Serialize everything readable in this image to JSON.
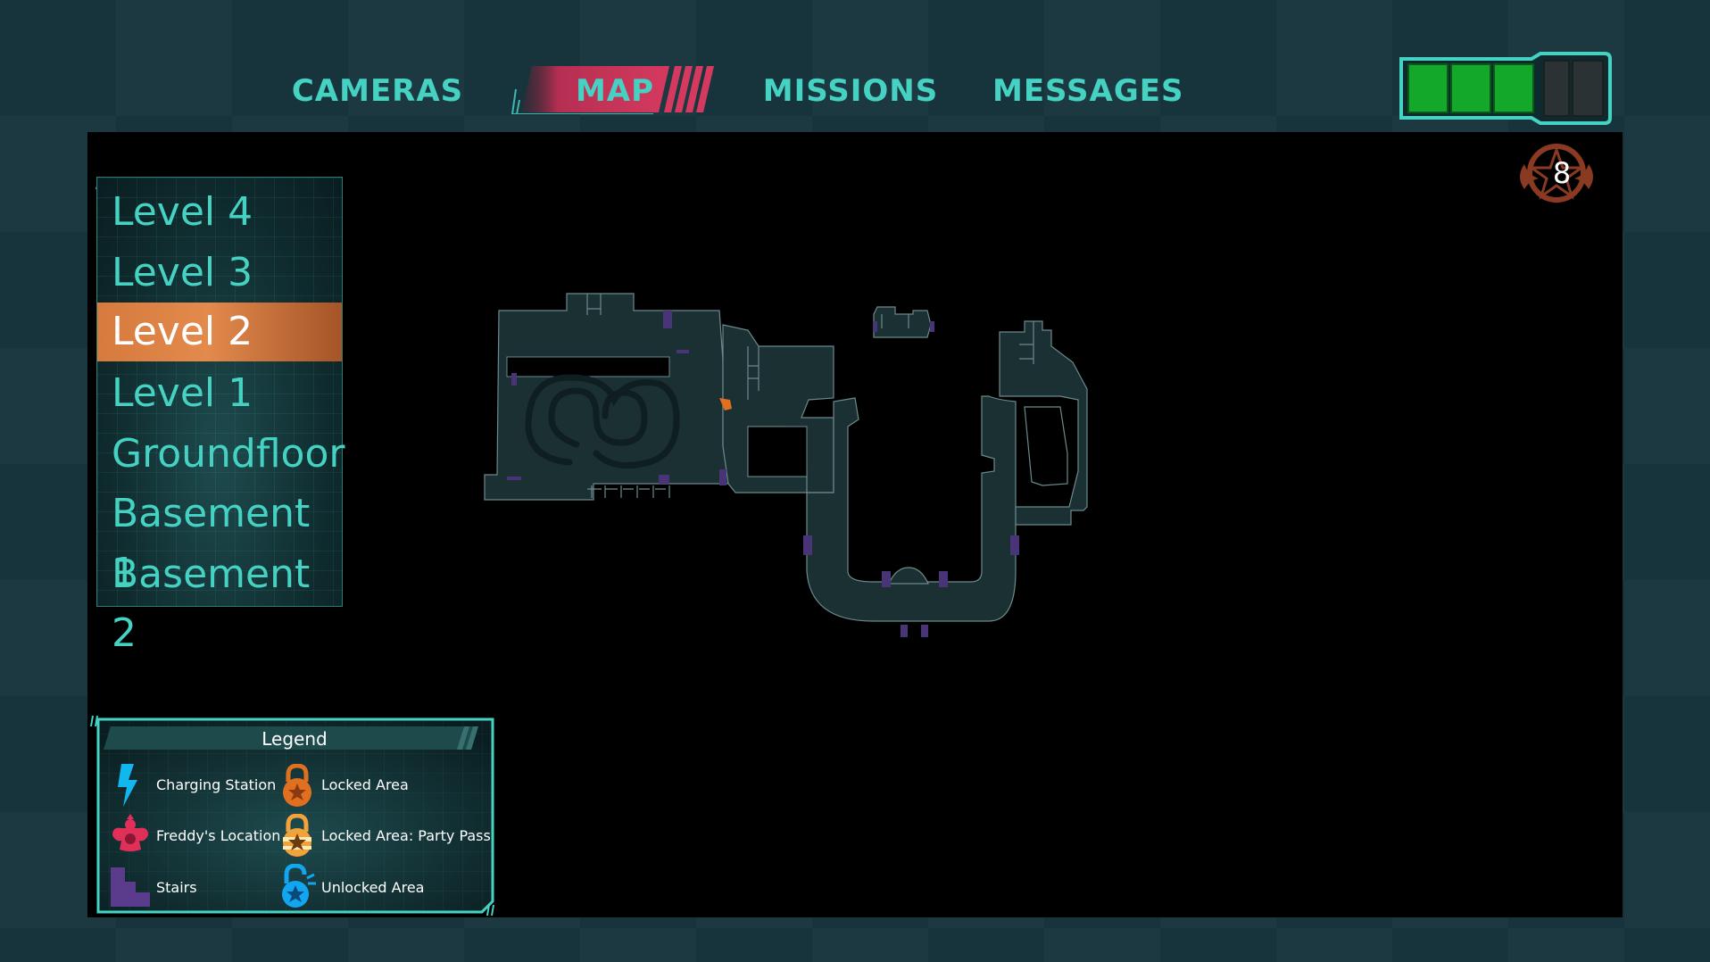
{
  "tabs": [
    {
      "label": "CAMERAS",
      "active": false
    },
    {
      "label": "MAP",
      "active": true
    },
    {
      "label": "MISSIONS",
      "active": false
    },
    {
      "label": "MESSAGES",
      "active": false
    }
  ],
  "battery": {
    "segments_total": 5,
    "segments_filled": 3,
    "fill_color": "#14a82a"
  },
  "badge": {
    "count": "8"
  },
  "levels": [
    {
      "label": "Level 4",
      "active": false
    },
    {
      "label": "Level 3",
      "active": false
    },
    {
      "label": "Level 2",
      "active": true
    },
    {
      "label": "Level 1",
      "active": false
    },
    {
      "label": "Groundfloor",
      "active": false
    },
    {
      "label": "Basement 1",
      "active": false
    },
    {
      "label": "Basement 2",
      "active": false
    }
  ],
  "legend": {
    "title": "Legend",
    "items": [
      {
        "label": "Charging Station",
        "icon": "lightning-icon"
      },
      {
        "label": "Locked Area",
        "icon": "lock-orange-icon"
      },
      {
        "label": "Freddy's Location",
        "icon": "freddy-icon"
      },
      {
        "label": "Locked Area: Party Pass",
        "icon": "lock-partypass-icon"
      },
      {
        "label": "Stairs",
        "icon": "stairs-icon"
      },
      {
        "label": "Unlocked Area",
        "icon": "unlock-blue-icon"
      }
    ]
  },
  "colors": {
    "accent": "#45d2c2",
    "active_tab": "#d6395f",
    "active_level": "#e38a4c",
    "map_fill": "#1b3033",
    "stairs": "#5a3b8c",
    "badge": "#8a3a22"
  }
}
